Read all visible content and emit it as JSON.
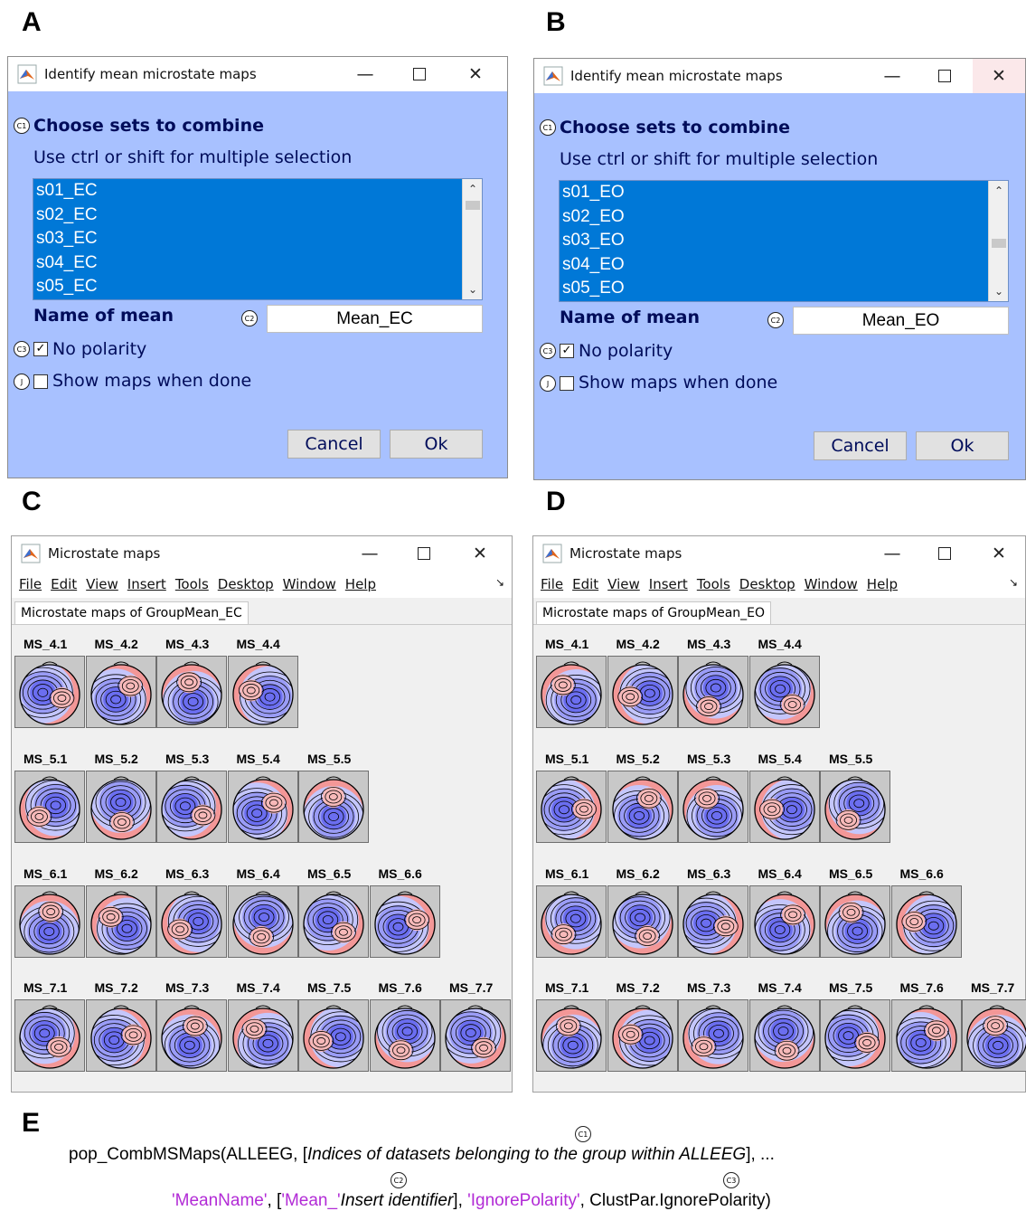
{
  "panel_labels": {
    "a": "A",
    "b": "B",
    "c": "C",
    "d": "D",
    "e": "E"
  },
  "colors": {
    "dialog_bg": "#a8c1ff",
    "list_selected": "#0078d7",
    "map_positive": "#f39797",
    "map_negative": "#6b6ef0",
    "code_string": "#b22bd6"
  },
  "dialogs": [
    {
      "title": "Identify mean microstate maps",
      "heading": "Choose sets to combine",
      "hint": "Use ctrl or shift for multiple selection",
      "datasets": [
        "s01_EC",
        "s02_EC",
        "s03_EC",
        "s04_EC",
        "s05_EC"
      ],
      "name_label": "Name of mean",
      "name_value": "Mean_EC",
      "no_polarity_label": "No polarity",
      "no_polarity_checked": true,
      "show_maps_label": "Show maps when done",
      "show_maps_checked": false,
      "cancel": "Cancel",
      "ok": "Ok",
      "markers": {
        "c1": "C1",
        "c2": "C2",
        "c3": "C3",
        "j": "J"
      }
    },
    {
      "title": "Identify mean microstate maps",
      "heading": "Choose sets to combine",
      "hint": "Use ctrl or shift for multiple selection",
      "datasets": [
        "s01_EO",
        "s02_EO",
        "s03_EO",
        "s04_EO",
        "s05_EO"
      ],
      "name_label": "Name of mean",
      "name_value": "Mean_EO",
      "no_polarity_label": "No polarity",
      "no_polarity_checked": true,
      "show_maps_label": "Show maps when done",
      "show_maps_checked": false,
      "cancel": "Cancel",
      "ok": "Ok",
      "markers": {
        "c1": "C1",
        "c2": "C2",
        "c3": "C3",
        "j": "J"
      }
    }
  ],
  "figures": [
    {
      "title": "Microstate maps",
      "menu": [
        "File",
        "Edit",
        "View",
        "Insert",
        "Tools",
        "Desktop",
        "Window",
        "Help"
      ],
      "tab": "Microstate maps of GroupMean_EC",
      "rows": [
        [
          "MS_4.1",
          "MS_4.2",
          "MS_4.3",
          "MS_4.4"
        ],
        [
          "MS_5.1",
          "MS_5.2",
          "MS_5.3",
          "MS_5.4",
          "MS_5.5"
        ],
        [
          "MS_6.1",
          "MS_6.2",
          "MS_6.3",
          "MS_6.4",
          "MS_6.5",
          "MS_6.6"
        ],
        [
          "MS_7.1",
          "MS_7.2",
          "MS_7.3",
          "MS_7.4",
          "MS_7.5",
          "MS_7.6",
          "MS_7.7"
        ]
      ]
    },
    {
      "title": "Microstate maps",
      "menu": [
        "File",
        "Edit",
        "View",
        "Insert",
        "Tools",
        "Desktop",
        "Window",
        "Help"
      ],
      "tab": "Microstate maps of GroupMean_EO",
      "rows": [
        [
          "MS_4.1",
          "MS_4.2",
          "MS_4.3",
          "MS_4.4"
        ],
        [
          "MS_5.1",
          "MS_5.2",
          "MS_5.3",
          "MS_5.4",
          "MS_5.5"
        ],
        [
          "MS_6.1",
          "MS_6.2",
          "MS_6.3",
          "MS_6.4",
          "MS_6.5",
          "MS_6.6"
        ],
        [
          "MS_7.1",
          "MS_7.2",
          "MS_7.3",
          "MS_7.4",
          "MS_7.5",
          "MS_7.6",
          "MS_7.7"
        ]
      ]
    }
  ],
  "code": {
    "line1_prefix": "pop_CombMSMaps(ALLEEG,  [",
    "line1_italic": "Indices of datasets belonging to the group within ALLEEG",
    "line1_suffix": "], ...",
    "line2_key1": "'MeanName'",
    "line2_sep1": ", [",
    "line2_str": "'Mean_'",
    "line2_italic": "Insert identifier",
    "line2_sep2": "], ",
    "line2_key2": "'IgnorePolarity'",
    "line2_suffix": ", ClustPar.IgnorePolarity)",
    "markers": {
      "c1": "C1",
      "c2": "C2",
      "c3": "C3"
    }
  }
}
